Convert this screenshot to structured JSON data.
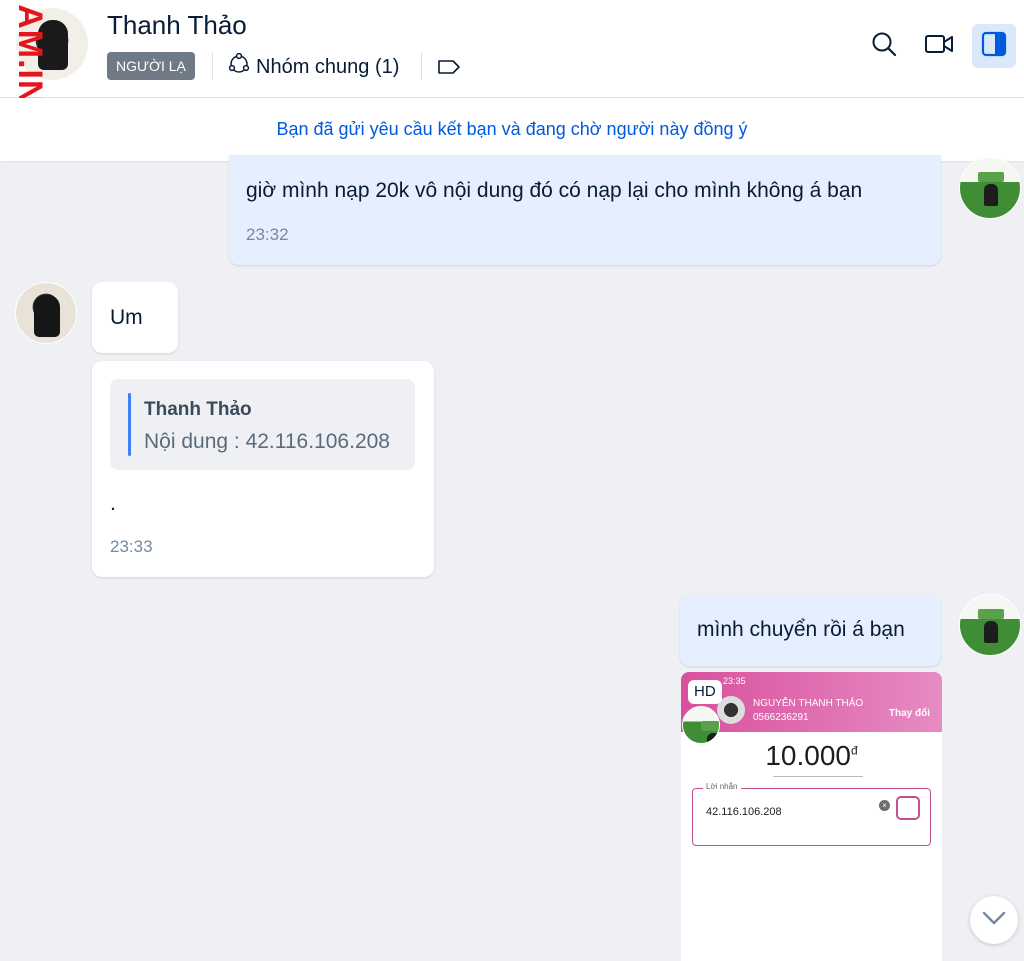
{
  "header": {
    "contact_name": "Thanh Thảo",
    "stranger_badge": "NGƯỜI LẠ",
    "common_groups": "Nhóm chung (1)",
    "icons": [
      "group-icon",
      "tag-icon",
      "search-icon",
      "video-call-icon",
      "sidebar-toggle-icon"
    ]
  },
  "watermark": "AM.INFO",
  "notice": "Bạn đã gửi yêu cầu kết bạn và đang chờ người này đồng ý",
  "messages": [
    {
      "from": "me",
      "text": "giờ mình nạp 20k vô nội dung đó có nạp lại cho mình không á bạn",
      "time": "23:32"
    },
    {
      "from": "them",
      "text": "Um"
    },
    {
      "from": "them",
      "quote_name": "Thanh Thảo",
      "quote_text": "Nội dung : 42.116.106.208",
      "text": ".",
      "time": "23:33"
    },
    {
      "from": "me",
      "text": "mình chuyển rồi á bạn"
    }
  ],
  "image_message": {
    "hd_label": "HD",
    "status_time": "23:35",
    "recipient_name": "NGUYỄN THANH THẢO",
    "recipient_phone": "0566236291",
    "change_label": "Thay đổi",
    "amount": "10.000",
    "currency": "đ",
    "note_label": "Lời nhắn",
    "note_value": "42.116.106.208"
  },
  "colors": {
    "accent": "#005ae0",
    "my_bubble": "#e5efff",
    "their_bubble": "#ffffff",
    "background": "#eef0f3",
    "momo_pink": "#d9509e"
  }
}
